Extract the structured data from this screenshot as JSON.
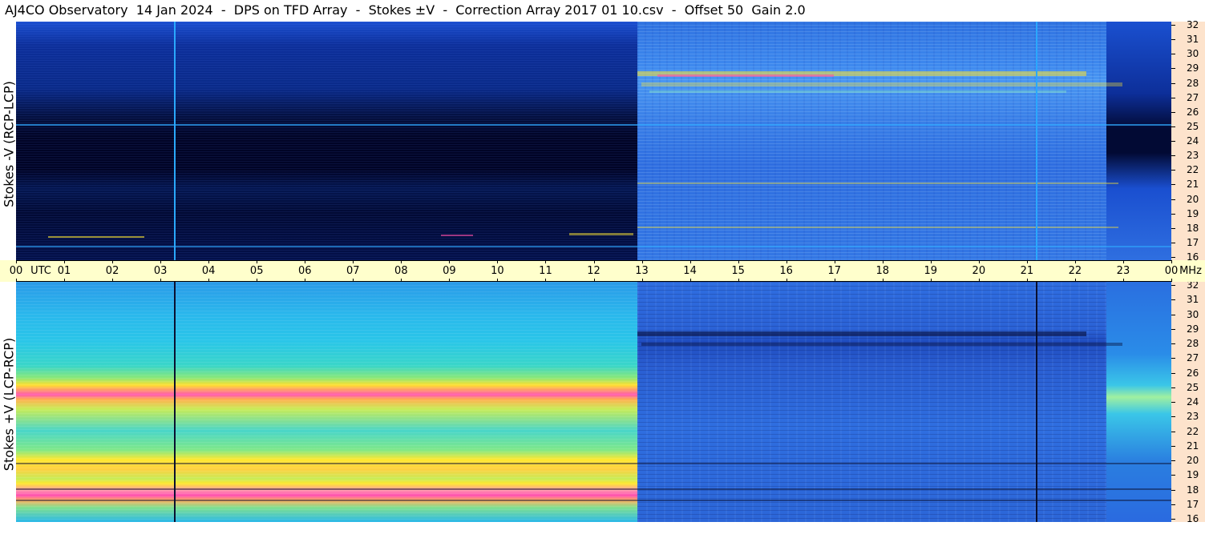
{
  "header": {
    "title": "AJ4CO Observatory  14 Jan 2024  -  DPS on TFD Array  -  Stokes ±V  -  Correction Array 2017 01 10.csv  -  Offset 50  Gain 2.0"
  },
  "chart_data": [
    {
      "type": "heatmap",
      "panel": "top",
      "ylabel": "Stokes -V (RCP-LCP)",
      "x_axis": {
        "unit": "UTC",
        "range_hours": [
          0,
          24
        ]
      },
      "y_axis": {
        "unit": "MHz",
        "range": [
          16,
          32
        ]
      },
      "colors": {
        "night_background": "#020a3a",
        "night_upper_band": "#0a2a88",
        "day_background": "#3a7de6",
        "hot": "#ff4faa",
        "warm": "#ffe830",
        "markers": "#2aa8ff"
      }
    },
    {
      "type": "heatmap",
      "panel": "bottom",
      "ylabel": "Stokes +V (LCP-RCP)",
      "x_axis": {
        "unit": "UTC",
        "range_hours": [
          0,
          24
        ]
      },
      "y_axis": {
        "unit": "MHz",
        "range": [
          16,
          32
        ]
      },
      "colors": {
        "night_background": "#2ac6e8",
        "hot": "#ff4fb0",
        "warm": "#ffe830",
        "day_background": "#2e66d8",
        "markers": "#0a1030"
      }
    }
  ],
  "time_axis": {
    "ticks": [
      "00",
      "01",
      "02",
      "03",
      "04",
      "05",
      "06",
      "07",
      "08",
      "09",
      "10",
      "11",
      "12",
      "13",
      "14",
      "15",
      "16",
      "17",
      "18",
      "19",
      "20",
      "21",
      "22",
      "23",
      "00"
    ],
    "utc_label": "UTC",
    "mhz_label": "MHz"
  },
  "freq_axis": {
    "ticks": [
      "32",
      "31",
      "30",
      "29",
      "28",
      "27",
      "26",
      "25",
      "24",
      "23",
      "22",
      "21",
      "20",
      "19",
      "18",
      "17",
      "16"
    ]
  }
}
